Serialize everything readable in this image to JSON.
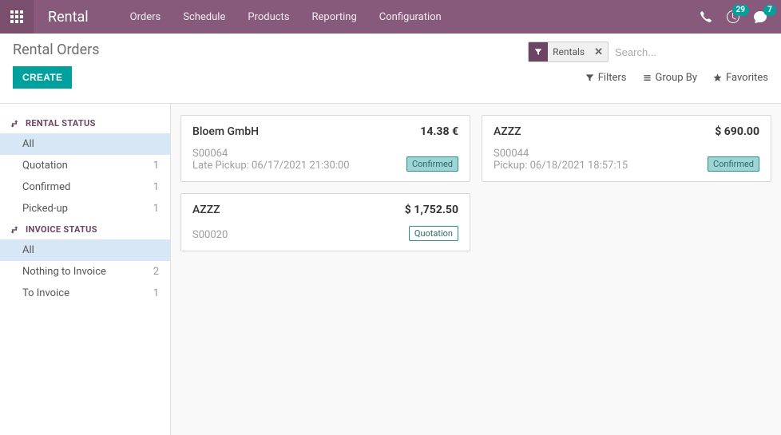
{
  "nav": {
    "brand": "Rental",
    "menu": [
      "Orders",
      "Schedule",
      "Products",
      "Reporting",
      "Configuration"
    ],
    "activity_count": "29",
    "messages_count": "7"
  },
  "control": {
    "breadcrumb": "Rental Orders",
    "create_label": "CREATE",
    "search_placeholder": "Search...",
    "facet_label": "Rentals",
    "filters_label": "Filters",
    "groupby_label": "Group By",
    "favorites_label": "Favorites"
  },
  "sidebar": {
    "groups": [
      {
        "title": "RENTAL STATUS",
        "items": [
          {
            "label": "All",
            "count": "",
            "active": true
          },
          {
            "label": "Quotation",
            "count": "1",
            "active": false
          },
          {
            "label": "Confirmed",
            "count": "1",
            "active": false
          },
          {
            "label": "Picked-up",
            "count": "1",
            "active": false
          }
        ]
      },
      {
        "title": "INVOICE STATUS",
        "items": [
          {
            "label": "All",
            "count": "",
            "active": true
          },
          {
            "label": "Nothing to Invoice",
            "count": "2",
            "active": false
          },
          {
            "label": "To Invoice",
            "count": "1",
            "active": false
          }
        ]
      }
    ]
  },
  "cards": {
    "col1": [
      {
        "title": "Bloem GmbH",
        "price": "14.38 €",
        "so": "S00064",
        "date": "Late Pickup: 06/17/2021 21:30:00",
        "status": "Confirmed",
        "status_class": "confirmed"
      },
      {
        "title": "AZZZ",
        "price": "$ 1,752.50",
        "so": "S00020",
        "date": "",
        "status": "Quotation",
        "status_class": "quotation"
      }
    ],
    "col2": [
      {
        "title": "AZZZ",
        "price": "$ 690.00",
        "so": "S00044",
        "date": "Pickup: 06/18/2021 18:57:15",
        "status": "Confirmed",
        "status_class": "confirmed"
      }
    ]
  }
}
